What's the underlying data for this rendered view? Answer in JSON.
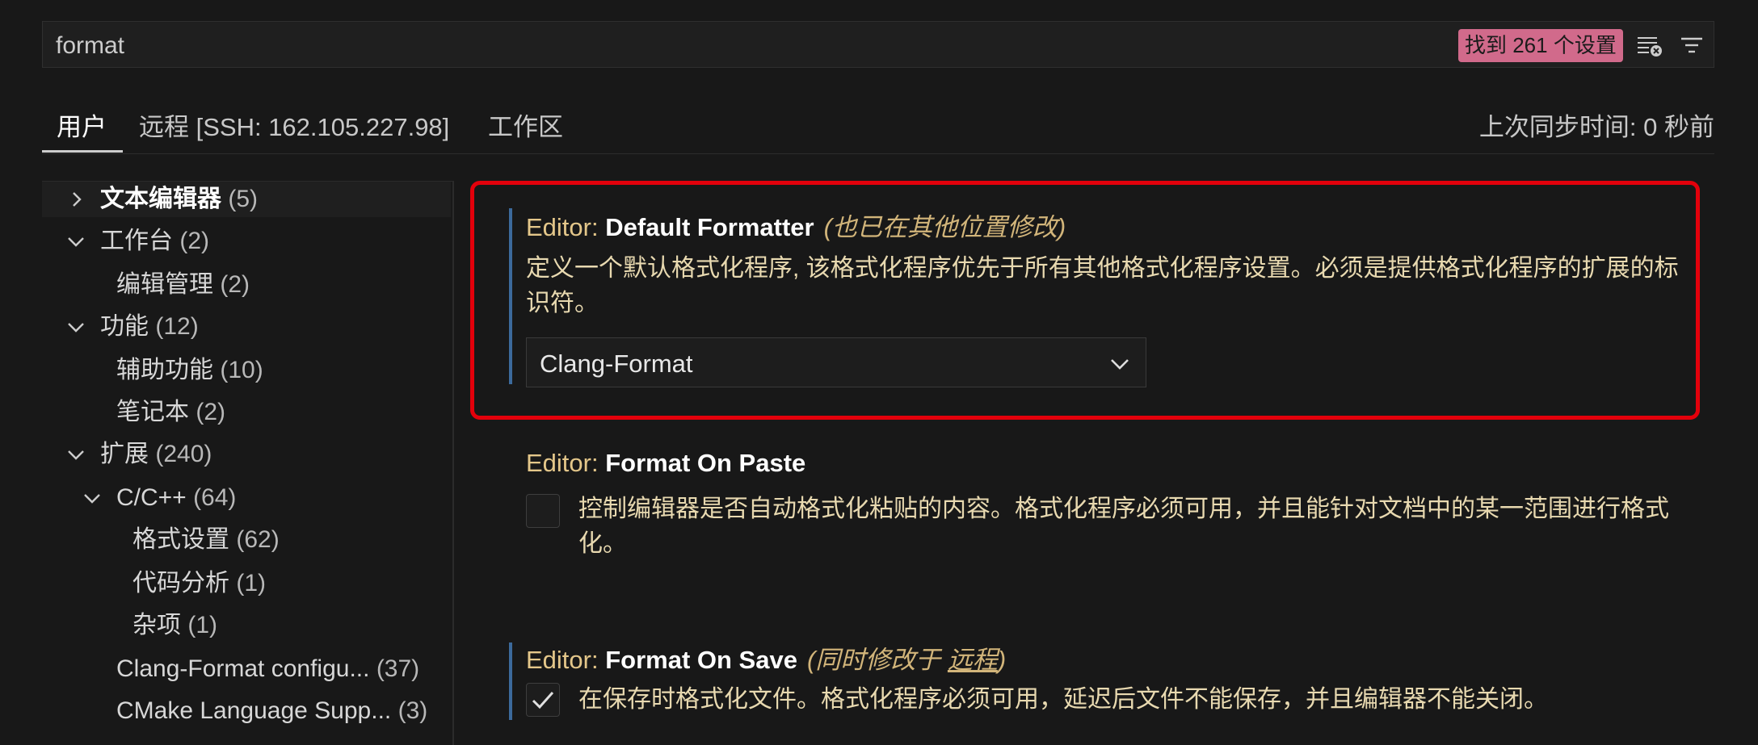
{
  "search": {
    "value": "format",
    "result_count": "找到 261 个设置"
  },
  "tabs": [
    {
      "label": "用户"
    },
    {
      "label": "远程 [SSH: 162.105.227.98]"
    },
    {
      "label": "工作区"
    }
  ],
  "sync_status": "上次同步时间: 0 秒前",
  "toc": [
    {
      "label": "文本编辑器",
      "count": "(5)"
    },
    {
      "label": "工作台",
      "count": "(2)"
    },
    {
      "label": "编辑管理",
      "count": "(2)"
    },
    {
      "label": "功能",
      "count": "(12)"
    },
    {
      "label": "辅助功能",
      "count": "(10)"
    },
    {
      "label": "笔记本",
      "count": "(2)"
    },
    {
      "label": "扩展",
      "count": "(240)"
    },
    {
      "label": "C/C++",
      "count": "(64)"
    },
    {
      "label": "格式设置",
      "count": "(62)"
    },
    {
      "label": "代码分析",
      "count": "(1)"
    },
    {
      "label": "杂项",
      "count": "(1)"
    },
    {
      "label": "Clang-Format configu...",
      "count": "(37)"
    },
    {
      "label": "CMake Language Supp...",
      "count": "(3)"
    }
  ],
  "settings": {
    "default_formatter": {
      "category": "Editor: ",
      "name": "Default Formatter",
      "modified": "(也已在其他位置修改)",
      "description": "定义一个默认格式化程序, 该格式化程序优先于所有其他格式化程序设置。必须是提供格式化程序的扩展的标识符。",
      "value": "Clang-Format"
    },
    "format_on_paste": {
      "category": "Editor: ",
      "name": "Format On Paste",
      "description": "控制编辑器是否自动格式化粘贴的内容。格式化程序必须可用，并且能针对文档中的某一范围进行格式化。",
      "checked": false
    },
    "format_on_save": {
      "category": "Editor: ",
      "name": "Format On Save",
      "modified_prefix": "(同时修改于 ",
      "modified_link": "远程",
      "modified_suffix": ")",
      "description": "在保存时格式化文件。格式化程序必须可用，延迟后文件不能保存，并且编辑器不能关闭。",
      "checked": true
    }
  },
  "colors": {
    "highlight_border": "#e3000b",
    "badge": "#d16a8b",
    "accent": "#3c6a9c"
  }
}
